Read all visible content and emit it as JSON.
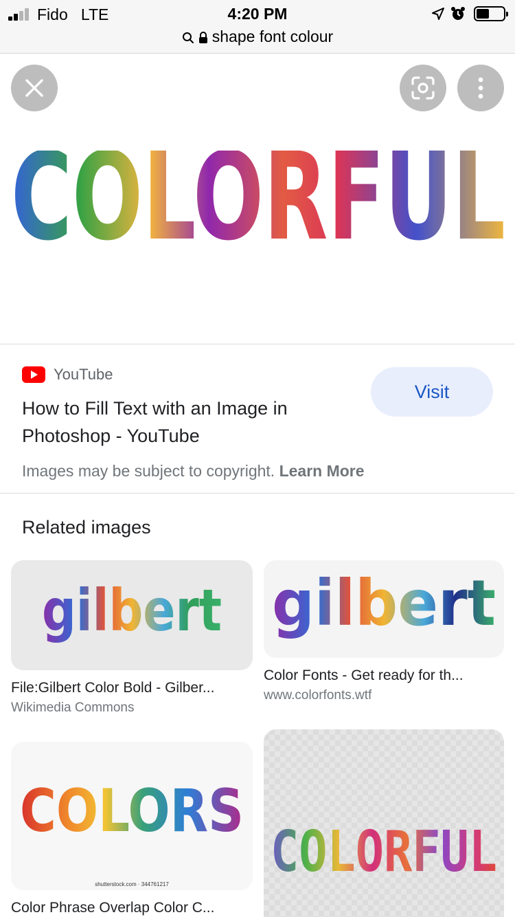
{
  "status_bar": {
    "carrier": "Fido",
    "network": "LTE",
    "time": "4:20 PM"
  },
  "url_bar": {
    "query": "shape font colour"
  },
  "viewer": {
    "image_text": "COLORFUL"
  },
  "source": {
    "site_name": "YouTube",
    "title": "How to Fill Text with an Image in Photoshop - YouTube",
    "visit_label": "Visit",
    "copyright_text": "Images may be subject to copyright.",
    "learn_more_label": "Learn More"
  },
  "related": {
    "heading": "Related images",
    "items": [
      {
        "caption": "File:Gilbert Color Bold - Gilber...",
        "site": "Wikimedia Commons",
        "image_text": "gilbert"
      },
      {
        "caption": "Color Fonts - Get ready for th...",
        "site": "www.colorfonts.wtf",
        "image_text": "gilbert"
      },
      {
        "caption": "Color Phrase Overlap Color C...",
        "site": "",
        "image_text": "COLORS",
        "watermark": "shutterstock.com · 344761217"
      },
      {
        "caption": "",
        "site": "",
        "image_text": "COLORFUL"
      }
    ]
  },
  "colors": {
    "visit_text": "#1a57c4",
    "visit_bg": "#e8eefc",
    "youtube_red": "#ff0000",
    "hero_letters": [
      "#2a5bd7",
      "#2e9e3a",
      "#f2b134",
      "#8b1da8",
      "#e2533a",
      "#d92b4f",
      "#3a48c8",
      "#f0b433"
    ]
  },
  "icons": {
    "search": "search-icon",
    "lock": "lock-icon",
    "close": "close-icon",
    "lens": "lens-icon",
    "more": "more-vertical-icon",
    "location": "location-arrow-icon",
    "alarm": "alarm-icon",
    "battery": "battery-icon",
    "youtube": "youtube-logo-icon"
  }
}
